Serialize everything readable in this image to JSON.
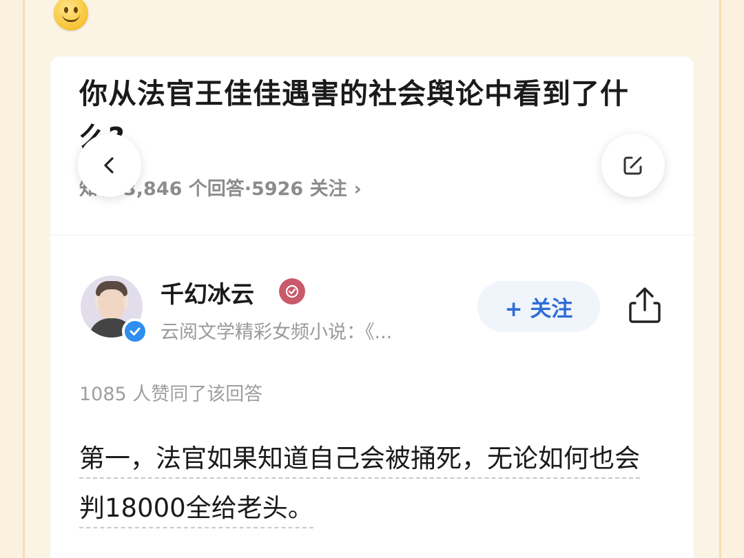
{
  "question": {
    "title": "你从法官王佳佳遇害的社会舆论中看到了什么?",
    "meta_prefix": "知乎",
    "meta": "3,846 个回答·5926 关注",
    "meta_chevron": "›"
  },
  "author": {
    "name": "千幻冰云",
    "description": "云阅文学精彩女频小说：《...",
    "follow_label": "+ 关注"
  },
  "answer": {
    "likes_text": "1085 人赞同了该回答",
    "paragraph": "第一，法官如果知道自己会被捅死，无论如何也会判18000全给老头。"
  },
  "icons": {
    "back": "chevron-left-icon",
    "edit": "edit-icon",
    "share": "share-icon",
    "verified": "verified-check-icon",
    "badge": "badge-icon",
    "emoji": "smiley-icon"
  },
  "colors": {
    "background": "#fbf3e4",
    "accent_blue": "#2c6dd8",
    "verified_blue": "#2f8ef0",
    "badge_red": "#c9596b"
  }
}
